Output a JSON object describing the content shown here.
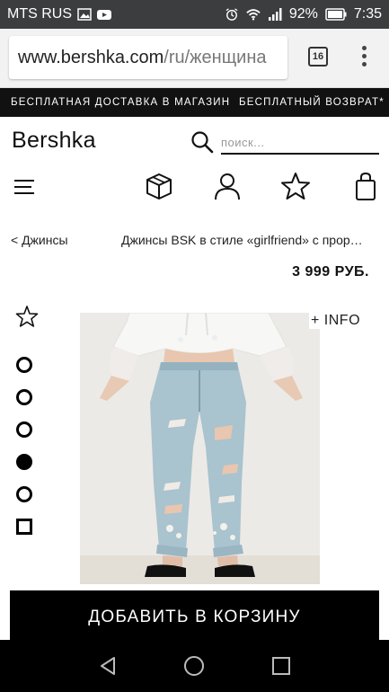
{
  "status_bar": {
    "carrier": "MTS RUS",
    "battery": "92%",
    "time": "7:35"
  },
  "browser": {
    "url_domain": "www.bershka.com",
    "url_path": "/ru/женщина",
    "tab_count": "16"
  },
  "promo": {
    "left": "БЕСПЛАТНАЯ ДОСТАВКА В МАГАЗИН",
    "right": "БЕСПЛАТНЫЙ ВОЗВРАТ*"
  },
  "header": {
    "brand": "Bershka",
    "search_placeholder": "поиск..."
  },
  "nav": {
    "icons": [
      "menu-icon",
      "box-icon",
      "user-icon",
      "star-icon",
      "shopping-bag-icon"
    ]
  },
  "product": {
    "breadcrumb": "< Джинсы",
    "title": "Джинсы BSK в стиле «girlfriend» с прорезями",
    "price": "3 999 РУБ.",
    "info_label": "+ INFO",
    "add_to_cart": "ДОБАВИТЬ В КОРЗИНУ",
    "active_thumbnail": 4,
    "thumbnail_count": 6
  },
  "colors": {
    "black": "#000000",
    "status_bar_bg": "#3b3d3f",
    "browser_bg": "#f2f2f2",
    "denim": "#a9c3cf"
  }
}
